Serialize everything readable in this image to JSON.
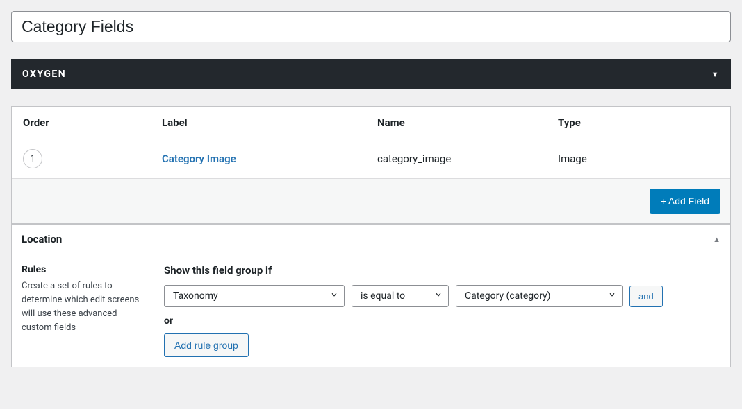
{
  "title": "Category Fields",
  "oxygen": {
    "label": "OXYGEN"
  },
  "fields_table": {
    "headers": {
      "order": "Order",
      "label": "Label",
      "name": "Name",
      "type": "Type"
    },
    "rows": [
      {
        "order": "1",
        "label": "Category Image",
        "name": "category_image",
        "type": "Image"
      }
    ],
    "add_field": "+ Add Field"
  },
  "location": {
    "title": "Location",
    "rules_heading": "Rules",
    "rules_desc": "Create a set of rules to determine which edit screens will use these advanced custom fields",
    "show_label": "Show this field group if",
    "rule": {
      "param": "Taxonomy",
      "operator": "is equal to",
      "value": "Category (category)",
      "and": "and"
    },
    "or_label": "or",
    "add_rule_group": "Add rule group"
  }
}
